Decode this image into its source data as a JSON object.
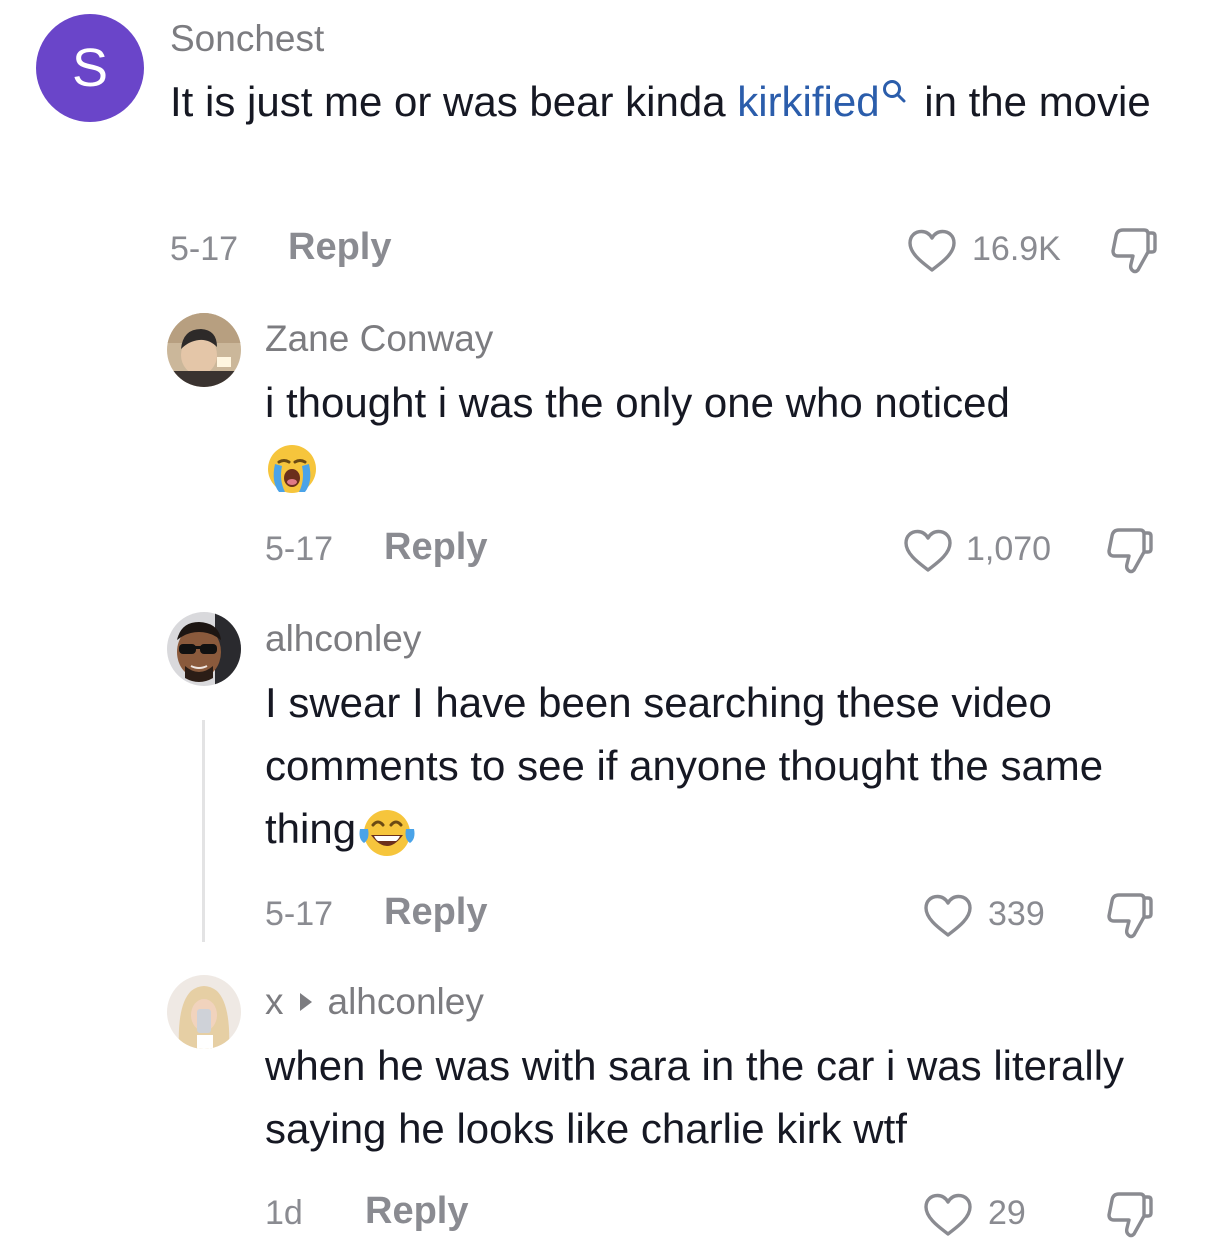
{
  "comments": [
    {
      "avatar_letter": "S",
      "username": "Sonchest",
      "text_before": "It is just me or was bear kinda ",
      "keyword": "kirkified",
      "keyword_icon": "search-icon",
      "text_after": " in the movie",
      "date": "5-17",
      "reply_label": "Reply",
      "likes": "16.9K"
    },
    {
      "username": "Zane Conway",
      "text": "i thought i was the only one who noticed",
      "emoji": "loudly-crying-face",
      "date": "5-17",
      "reply_label": "Reply",
      "likes": "1,070"
    },
    {
      "username": "alhconley",
      "text": "I swear I have been searching these video comments to see if anyone thought the same thing",
      "emoji": "face-with-tears-of-joy",
      "date": "5-17",
      "reply_label": "Reply",
      "likes": "339"
    },
    {
      "username": "x",
      "reply_to": "alhconley",
      "text": "when he was with sara in the car i was literally saying he looks like charlie kirk wtf",
      "date": "1d",
      "reply_label": "Reply",
      "likes": "29"
    }
  ],
  "colors": {
    "avatar_bg": "#6a45c9",
    "keyword_link": "#2b5dab",
    "meta_text": "#8a8b91"
  }
}
